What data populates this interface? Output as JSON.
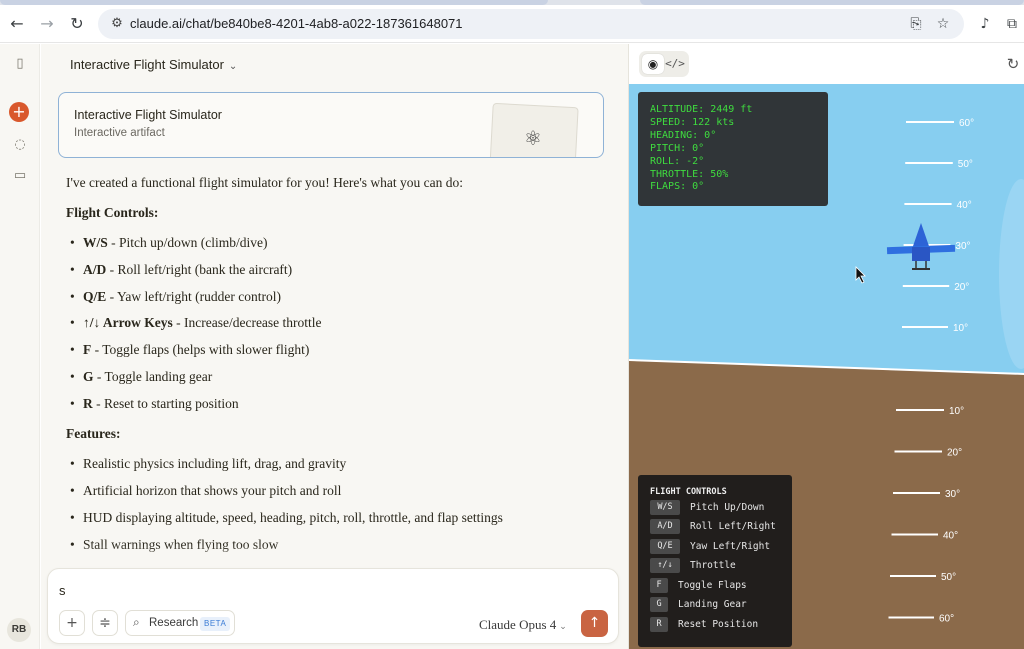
{
  "browser": {
    "url": "claude.ai/chat/be840be8-4201-4ab8-a022-187361648071",
    "icons": {
      "back": "back-arrow-icon",
      "forward": "forward-arrow-icon",
      "reload": "reload-icon",
      "site_settings": "tune-icon",
      "install": "install-app-icon",
      "bookmark": "star-icon",
      "voice": "microphone-icon",
      "extensions": "puzzle-icon"
    }
  },
  "sidebar": {
    "icons": [
      "sidebar-toggle-icon",
      "new-chat-icon",
      "chats-icon",
      "projects-icon"
    ],
    "avatar": "RB",
    "accent": "#d9582c"
  },
  "chat": {
    "title": "Interactive Flight Simulator",
    "artifact": {
      "title": "Interactive Flight Simulator",
      "subtitle": "Interactive artifact",
      "icon": "atom-icon"
    },
    "intro": "I've created a functional flight simulator for you! Here's what you can do:",
    "controls_heading": "Flight Controls:",
    "controls": [
      {
        "key": "W/S",
        "text": " - Pitch up/down (climb/dive)"
      },
      {
        "key": "A/D",
        "text": " - Roll left/right (bank the aircraft)"
      },
      {
        "key": "Q/E",
        "text": " - Yaw left/right (rudder control)"
      },
      {
        "key": "↑/↓ Arrow Keys",
        "text": " - Increase/decrease throttle"
      },
      {
        "key": "F",
        "text": " - Toggle flaps (helps with slower flight)"
      },
      {
        "key": "G",
        "text": " - Toggle landing gear"
      },
      {
        "key": "R",
        "text": " - Reset to starting position"
      }
    ],
    "features_heading": "Features:",
    "features": [
      "Realistic physics including lift, drag, and gravity",
      "Artificial horizon that shows your pitch and roll",
      "HUD displaying altitude, speed, heading, pitch, roll, throttle, and flap settings",
      "Stall warnings when flying too slow"
    ]
  },
  "composer": {
    "typed_text": "s",
    "research_label": "Research",
    "beta_label": "BETA",
    "model": "Claude Opus 4",
    "send_color": "#c96442"
  },
  "preview": {
    "hud": [
      "ALTITUDE: 2449 ft",
      "SPEED: 122 kts",
      "HEADING: 0°",
      "PITCH: 0°",
      "ROLL: -2°",
      "THROTTLE: 50%",
      "FLAPS: 0°"
    ],
    "hud_color": "#3fdc3f",
    "sky_color": "#87cef0",
    "ground_color": "#8b6a4a",
    "pitch_ladder_up": [
      "60°",
      "50°",
      "40°",
      "30°",
      "20°",
      "10°"
    ],
    "pitch_ladder_down": [
      "10°",
      "20°",
      "30°",
      "40°",
      "50°",
      "60°"
    ],
    "controls_title": "FLIGHT CONTROLS",
    "controls": [
      {
        "key": "W/S",
        "action": "Pitch Up/Down"
      },
      {
        "key": "A/D",
        "action": "Roll Left/Right"
      },
      {
        "key": "Q/E",
        "action": "Yaw Left/Right"
      },
      {
        "key": "↑/↓",
        "action": "Throttle"
      },
      {
        "key": "F",
        "action": "Toggle Flaps"
      },
      {
        "key": "G",
        "action": "Landing Gear"
      },
      {
        "key": "R",
        "action": "Reset Position"
      }
    ]
  }
}
